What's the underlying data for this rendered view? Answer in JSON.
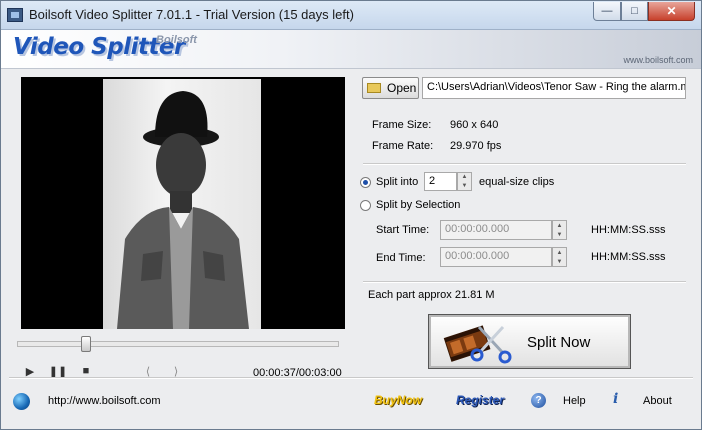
{
  "window": {
    "title": "Boilsoft Video Splitter 7.01.1 - Trial Version (15 days left)"
  },
  "banner": {
    "logo": "Video Splitter",
    "brand": "Boilsoft",
    "url": "www.boilsoft.com"
  },
  "player": {
    "time": "00:00:37/00:03:00",
    "progress_fraction": 0.205
  },
  "file": {
    "open_label": "Open",
    "path": "C:\\Users\\Adrian\\Videos\\Tenor Saw - Ring the alarm.m"
  },
  "info": {
    "frame_size_label": "Frame Size:",
    "frame_size_value": "960 x 640",
    "frame_rate_label": "Frame Rate:",
    "frame_rate_value": "29.970 fps"
  },
  "split_options": {
    "split_into_label": "Split into",
    "split_into_value": "2",
    "split_into_suffix": "equal-size clips",
    "split_by_selection_label": "Split by Selection",
    "start_time_label": "Start Time:",
    "start_time_value": "00:00:00.000",
    "end_time_label": "End Time:",
    "end_time_value": "00:00:00.000",
    "time_format": "HH:MM:SS.sss",
    "each_part": "Each part approx 21.81 M"
  },
  "split_button": {
    "label": "Split Now"
  },
  "footer": {
    "website": "http://www.boilsoft.com",
    "buy_now": "BuyNow",
    "register": "Register",
    "help": "Help",
    "about": "About"
  }
}
